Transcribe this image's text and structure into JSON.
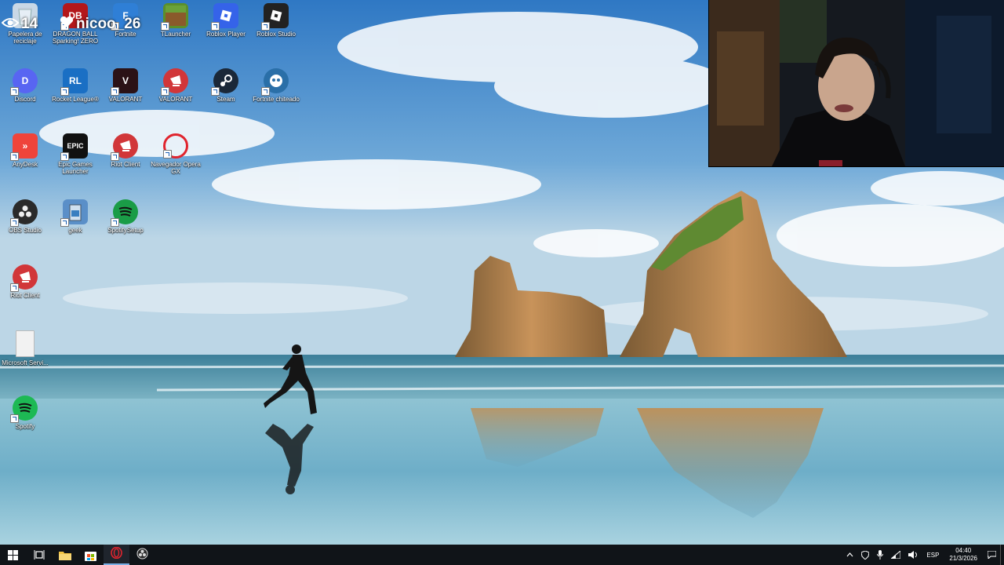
{
  "overlay": {
    "viewers": "14",
    "viewer_icon": "eye-icon",
    "channel": "nicoo_26",
    "heart_icon": "heart-icon"
  },
  "desktop_icons": [
    {
      "label": "Papelera de reciclaje",
      "icon": "recycle-bin-icon",
      "color": "#c9d8e6"
    },
    {
      "label": "DRAGON BALL Sparking! ZERO",
      "icon": "dragon-ball-icon",
      "color": "#b3171b"
    },
    {
      "label": "Fortnite",
      "icon": "fortnite-icon",
      "color": "#2f7fd6"
    },
    {
      "label": "TLauncher",
      "icon": "tlauncher-icon",
      "color": "#5b8f2b"
    },
    {
      "label": "Roblox Player",
      "icon": "roblox-player-icon",
      "color": "#3563e9"
    },
    {
      "label": "Roblox Studio",
      "icon": "roblox-studio-icon",
      "color": "#222222"
    },
    {
      "label": "Discord",
      "icon": "discord-icon",
      "color": "#5865f2"
    },
    {
      "label": "Rocket League®",
      "icon": "rocket-league-icon",
      "color": "#1a6fc4"
    },
    {
      "label": "VALORANT",
      "icon": "valorant-icon",
      "color": "#2b1216"
    },
    {
      "label": "VALORANT",
      "icon": "riot-valorant-icon",
      "color": "#d13639"
    },
    {
      "label": "Steam",
      "icon": "steam-icon",
      "color": "#1b2838"
    },
    {
      "label": "Fortnite chiteado",
      "icon": "fortnite-chiteado-icon",
      "color": "#2a6fa8"
    },
    {
      "label": "AnyDesk",
      "icon": "anydesk-icon",
      "color": "#ef443b"
    },
    {
      "label": "Epic Games Launcher",
      "icon": "epic-games-icon",
      "color": "#111111"
    },
    {
      "label": "Riot Client",
      "icon": "riot-client-icon",
      "color": "#d13639"
    },
    {
      "label": "Navegador Opera GX",
      "icon": "opera-gx-icon",
      "color": "#fafafa"
    },
    {
      "label": "OBS Studio",
      "icon": "obs-studio-icon",
      "color": "#2a2a2a"
    },
    {
      "label": "geek",
      "icon": "geek-uninstaller-icon",
      "color": "#5a8fc8"
    },
    {
      "label": "SpotifySetup",
      "icon": "spotify-setup-icon",
      "color": "#1a9c47"
    },
    {
      "label": "Riot Client",
      "icon": "riot-client-icon",
      "color": "#d13639"
    },
    {
      "label": "Microsoft Servi...",
      "icon": "document-file-icon",
      "color": "#f2f2f2"
    },
    {
      "label": "Spotify",
      "icon": "spotify-icon",
      "color": "#1db954"
    }
  ],
  "taskbar": {
    "start_icon": "windows-start-icon",
    "task_view_icon": "task-view-icon",
    "pinned": [
      {
        "name": "file-explorer-icon",
        "color": "#f4c542"
      },
      {
        "name": "microsoft-store-icon",
        "color": "#ffffff"
      },
      {
        "name": "opera-gx-icon",
        "color": "#e0242e"
      },
      {
        "name": "obs-studio-icon",
        "color": "#dddddd"
      }
    ],
    "tray": {
      "chevron_icon": "chevron-up-icon",
      "language": "ESP",
      "time": "04:40",
      "date": "21/3/2026"
    }
  }
}
